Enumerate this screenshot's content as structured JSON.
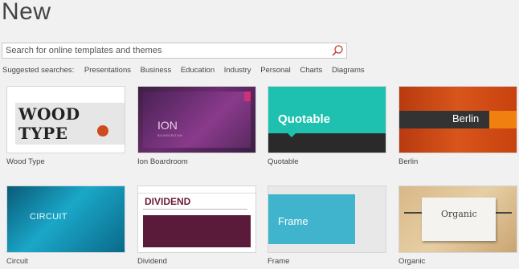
{
  "header": {
    "title": "New"
  },
  "search": {
    "placeholder": "Search for online templates and themes",
    "icon": "search-icon"
  },
  "suggested": {
    "label": "Suggested searches:",
    "items": [
      "Presentations",
      "Business",
      "Education",
      "Industry",
      "Personal",
      "Charts",
      "Diagrams"
    ]
  },
  "templates": [
    {
      "name": "Wood Type",
      "thumb_text": "WOOD TYPE"
    },
    {
      "name": "Ion Boardroom",
      "thumb_text": "ION",
      "thumb_sub": "BOARDROOM"
    },
    {
      "name": "Quotable",
      "thumb_text": "Quotable"
    },
    {
      "name": "Berlin",
      "thumb_text": "Berlin"
    },
    {
      "name": "Circuit",
      "thumb_text": "CIRCUIT"
    },
    {
      "name": "Dividend",
      "thumb_text": "DIVIDEND"
    },
    {
      "name": "Frame",
      "thumb_text": "Frame"
    },
    {
      "name": "Organic",
      "thumb_text": "Organic"
    }
  ],
  "colors": {
    "background": "#f1f1f1",
    "search_icon": "#c0392b"
  }
}
